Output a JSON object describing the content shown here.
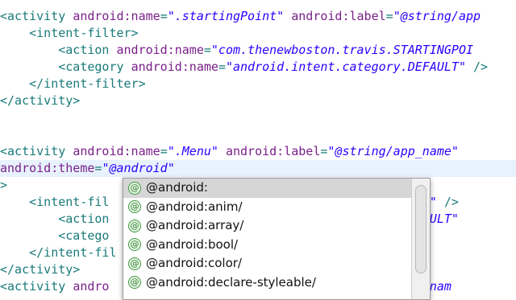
{
  "editor": {
    "lines": [
      {
        "parts": [
          [
            "tag",
            "<activity "
          ],
          [
            "attr",
            "android:name"
          ],
          [
            "punct",
            "="
          ],
          [
            "str",
            "\".startingPoint\""
          ],
          [
            "plain",
            " "
          ],
          [
            "attr",
            "android:label"
          ],
          [
            "punct",
            "="
          ],
          [
            "str",
            "\"@string/app"
          ]
        ]
      },
      {
        "parts": [
          [
            "plain",
            "    "
          ],
          [
            "tag",
            "<intent-filter>"
          ]
        ]
      },
      {
        "parts": [
          [
            "plain",
            "        "
          ],
          [
            "tag",
            "<action "
          ],
          [
            "attr",
            "android:name"
          ],
          [
            "punct",
            "="
          ],
          [
            "str",
            "\"com.thenewboston.travis.STARTINGPOI"
          ]
        ]
      },
      {
        "parts": [
          [
            "plain",
            "        "
          ],
          [
            "tag",
            "<category "
          ],
          [
            "attr",
            "android:name"
          ],
          [
            "punct",
            "="
          ],
          [
            "str",
            "\"android.intent.category.DEFAULT\""
          ],
          [
            "plain",
            " "
          ],
          [
            "tag",
            "/>"
          ]
        ]
      },
      {
        "parts": [
          [
            "plain",
            "    "
          ],
          [
            "tag",
            "</intent-filter>"
          ]
        ]
      },
      {
        "parts": [
          [
            "tag",
            "</activity>"
          ]
        ]
      },
      {
        "parts": []
      },
      {
        "parts": []
      },
      {
        "parts": [
          [
            "tag",
            "<activity "
          ],
          [
            "attr",
            "android:name"
          ],
          [
            "punct",
            "="
          ],
          [
            "str",
            "\".Menu\""
          ],
          [
            "plain",
            " "
          ],
          [
            "attr",
            "android:label"
          ],
          [
            "punct",
            "="
          ],
          [
            "str",
            "\"@string/app_name\""
          ]
        ]
      },
      {
        "parts": [
          [
            "attr",
            "android:theme"
          ],
          [
            "punct",
            "="
          ],
          [
            "str",
            "\"@android\""
          ]
        ]
      },
      {
        "parts": [
          [
            "tag",
            ">"
          ]
        ]
      },
      {
        "parts": [
          [
            "plain",
            "    "
          ],
          [
            "tag",
            "<intent-fil"
          ],
          [
            "plain",
            "                                        "
          ],
          [
            "str",
            "MENU\""
          ],
          [
            "plain",
            " "
          ],
          [
            "tag",
            "/>"
          ]
        ]
      },
      {
        "parts": [
          [
            "plain",
            "        "
          ],
          [
            "tag",
            "<action"
          ],
          [
            "plain",
            "                                      "
          ],
          [
            "str",
            "y.DEFAULT\""
          ]
        ]
      },
      {
        "parts": [
          [
            "plain",
            "        "
          ],
          [
            "tag",
            "<catego"
          ]
        ]
      },
      {
        "parts": [
          [
            "plain",
            "    "
          ],
          [
            "tag",
            "</intent-fil"
          ]
        ]
      },
      {
        "parts": [
          [
            "tag",
            "</activity>"
          ]
        ]
      },
      {
        "parts": [
          [
            "tag",
            "<activity "
          ],
          [
            "attr",
            "andro"
          ],
          [
            "plain",
            "                                       "
          ],
          [
            "str",
            "/app_nam"
          ]
        ]
      }
    ],
    "cursor_line": 9
  },
  "autocomplete": {
    "icon_glyph": "@",
    "items": [
      "@android:",
      "@android:anim/",
      "@android:array/",
      "@android:bool/",
      "@android:color/",
      "@android:declare-styleable/"
    ],
    "selected_index": 0
  }
}
